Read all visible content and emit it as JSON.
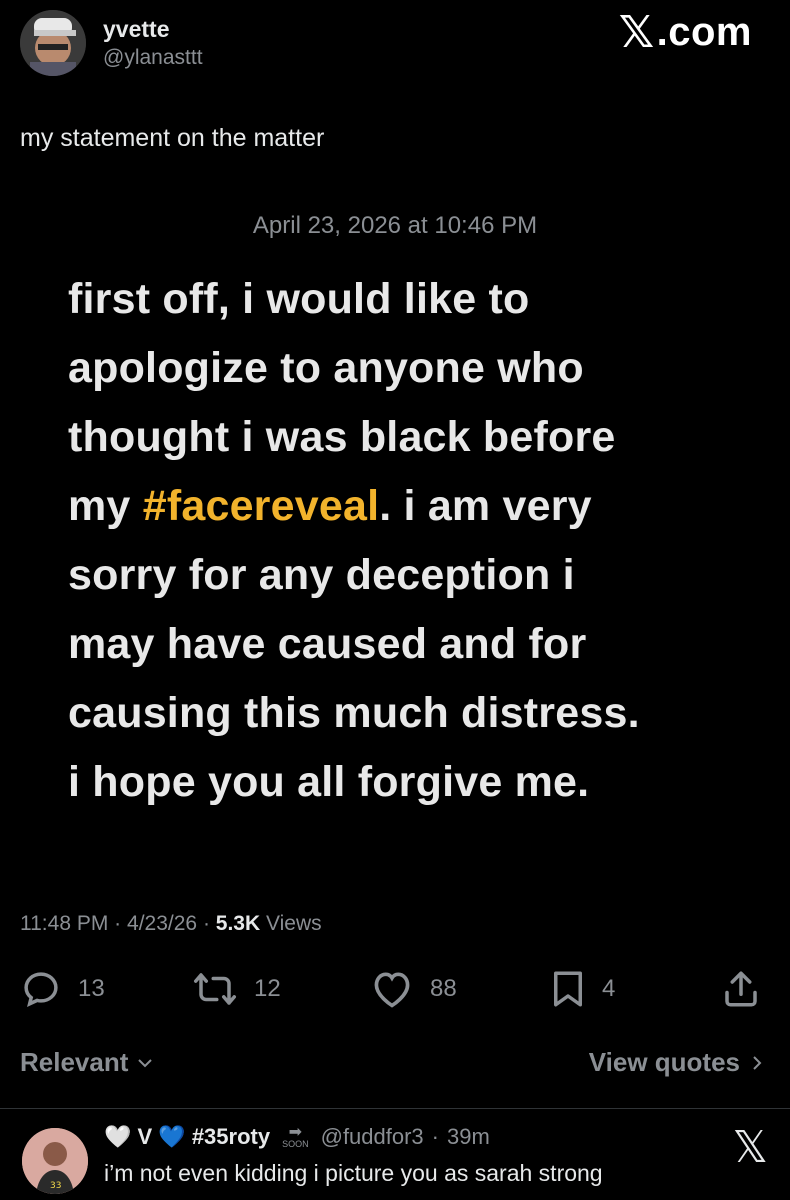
{
  "header": {
    "display_name": "yvette",
    "handle": "@ylanasttt",
    "brand_mark": "𝕏",
    "brand_text": ".com"
  },
  "tweet": {
    "text": "my statement on the matter"
  },
  "statement": {
    "timestamp": "April 23, 2026 at 10:46 PM",
    "line1": "first off, i would like to",
    "line2": "apologize to anyone who",
    "line3": "thought i was black before",
    "line4_pre": "my ",
    "line4_hashtag": "#facereveal",
    "line4_post": ". i am very",
    "line5": "sorry for any deception i",
    "line6": "may have caused and for",
    "line7": "causing this much distress.",
    "line8": "i hope you all forgive me."
  },
  "meta": {
    "time": "11:48 PM",
    "sep1": "·",
    "date": "4/23/26",
    "sep2": "·",
    "views_count": "5.3K",
    "views_label": "Views"
  },
  "actions": {
    "replies": "13",
    "reposts": "12",
    "likes": "88",
    "bookmarks": "4"
  },
  "sort": {
    "label": "Relevant",
    "view_quotes": "View quotes"
  },
  "reply": {
    "name_prefix": "🤍 V 💙",
    "name_tag": "#35roty",
    "soon_label": "SOON",
    "handle": "@fuddfor3",
    "sep": "·",
    "time": "39m",
    "text": "i’m not even kidding i picture you as sarah strong",
    "badge": "𝕏"
  },
  "colors": {
    "background": "#000000",
    "hashtag": "#f2b32c",
    "muted": "#8b8f94",
    "text": "#e7e9ea"
  }
}
